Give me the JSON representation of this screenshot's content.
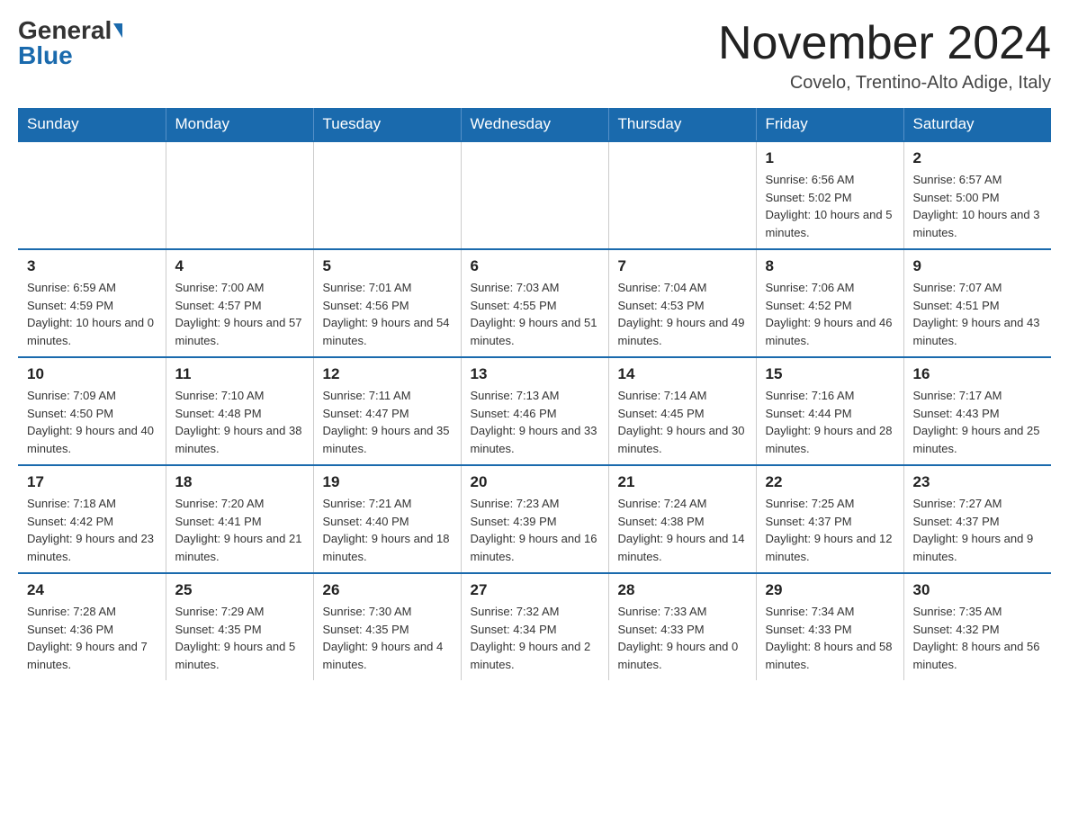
{
  "header": {
    "logo_general": "General",
    "logo_blue": "Blue",
    "month_title": "November 2024",
    "location": "Covelo, Trentino-Alto Adige, Italy"
  },
  "weekdays": [
    "Sunday",
    "Monday",
    "Tuesday",
    "Wednesday",
    "Thursday",
    "Friday",
    "Saturday"
  ],
  "weeks": [
    [
      {
        "day": "",
        "info": ""
      },
      {
        "day": "",
        "info": ""
      },
      {
        "day": "",
        "info": ""
      },
      {
        "day": "",
        "info": ""
      },
      {
        "day": "",
        "info": ""
      },
      {
        "day": "1",
        "info": "Sunrise: 6:56 AM\nSunset: 5:02 PM\nDaylight: 10 hours and 5 minutes."
      },
      {
        "day": "2",
        "info": "Sunrise: 6:57 AM\nSunset: 5:00 PM\nDaylight: 10 hours and 3 minutes."
      }
    ],
    [
      {
        "day": "3",
        "info": "Sunrise: 6:59 AM\nSunset: 4:59 PM\nDaylight: 10 hours and 0 minutes."
      },
      {
        "day": "4",
        "info": "Sunrise: 7:00 AM\nSunset: 4:57 PM\nDaylight: 9 hours and 57 minutes."
      },
      {
        "day": "5",
        "info": "Sunrise: 7:01 AM\nSunset: 4:56 PM\nDaylight: 9 hours and 54 minutes."
      },
      {
        "day": "6",
        "info": "Sunrise: 7:03 AM\nSunset: 4:55 PM\nDaylight: 9 hours and 51 minutes."
      },
      {
        "day": "7",
        "info": "Sunrise: 7:04 AM\nSunset: 4:53 PM\nDaylight: 9 hours and 49 minutes."
      },
      {
        "day": "8",
        "info": "Sunrise: 7:06 AM\nSunset: 4:52 PM\nDaylight: 9 hours and 46 minutes."
      },
      {
        "day": "9",
        "info": "Sunrise: 7:07 AM\nSunset: 4:51 PM\nDaylight: 9 hours and 43 minutes."
      }
    ],
    [
      {
        "day": "10",
        "info": "Sunrise: 7:09 AM\nSunset: 4:50 PM\nDaylight: 9 hours and 40 minutes."
      },
      {
        "day": "11",
        "info": "Sunrise: 7:10 AM\nSunset: 4:48 PM\nDaylight: 9 hours and 38 minutes."
      },
      {
        "day": "12",
        "info": "Sunrise: 7:11 AM\nSunset: 4:47 PM\nDaylight: 9 hours and 35 minutes."
      },
      {
        "day": "13",
        "info": "Sunrise: 7:13 AM\nSunset: 4:46 PM\nDaylight: 9 hours and 33 minutes."
      },
      {
        "day": "14",
        "info": "Sunrise: 7:14 AM\nSunset: 4:45 PM\nDaylight: 9 hours and 30 minutes."
      },
      {
        "day": "15",
        "info": "Sunrise: 7:16 AM\nSunset: 4:44 PM\nDaylight: 9 hours and 28 minutes."
      },
      {
        "day": "16",
        "info": "Sunrise: 7:17 AM\nSunset: 4:43 PM\nDaylight: 9 hours and 25 minutes."
      }
    ],
    [
      {
        "day": "17",
        "info": "Sunrise: 7:18 AM\nSunset: 4:42 PM\nDaylight: 9 hours and 23 minutes."
      },
      {
        "day": "18",
        "info": "Sunrise: 7:20 AM\nSunset: 4:41 PM\nDaylight: 9 hours and 21 minutes."
      },
      {
        "day": "19",
        "info": "Sunrise: 7:21 AM\nSunset: 4:40 PM\nDaylight: 9 hours and 18 minutes."
      },
      {
        "day": "20",
        "info": "Sunrise: 7:23 AM\nSunset: 4:39 PM\nDaylight: 9 hours and 16 minutes."
      },
      {
        "day": "21",
        "info": "Sunrise: 7:24 AM\nSunset: 4:38 PM\nDaylight: 9 hours and 14 minutes."
      },
      {
        "day": "22",
        "info": "Sunrise: 7:25 AM\nSunset: 4:37 PM\nDaylight: 9 hours and 12 minutes."
      },
      {
        "day": "23",
        "info": "Sunrise: 7:27 AM\nSunset: 4:37 PM\nDaylight: 9 hours and 9 minutes."
      }
    ],
    [
      {
        "day": "24",
        "info": "Sunrise: 7:28 AM\nSunset: 4:36 PM\nDaylight: 9 hours and 7 minutes."
      },
      {
        "day": "25",
        "info": "Sunrise: 7:29 AM\nSunset: 4:35 PM\nDaylight: 9 hours and 5 minutes."
      },
      {
        "day": "26",
        "info": "Sunrise: 7:30 AM\nSunset: 4:35 PM\nDaylight: 9 hours and 4 minutes."
      },
      {
        "day": "27",
        "info": "Sunrise: 7:32 AM\nSunset: 4:34 PM\nDaylight: 9 hours and 2 minutes."
      },
      {
        "day": "28",
        "info": "Sunrise: 7:33 AM\nSunset: 4:33 PM\nDaylight: 9 hours and 0 minutes."
      },
      {
        "day": "29",
        "info": "Sunrise: 7:34 AM\nSunset: 4:33 PM\nDaylight: 8 hours and 58 minutes."
      },
      {
        "day": "30",
        "info": "Sunrise: 7:35 AM\nSunset: 4:32 PM\nDaylight: 8 hours and 56 minutes."
      }
    ]
  ]
}
